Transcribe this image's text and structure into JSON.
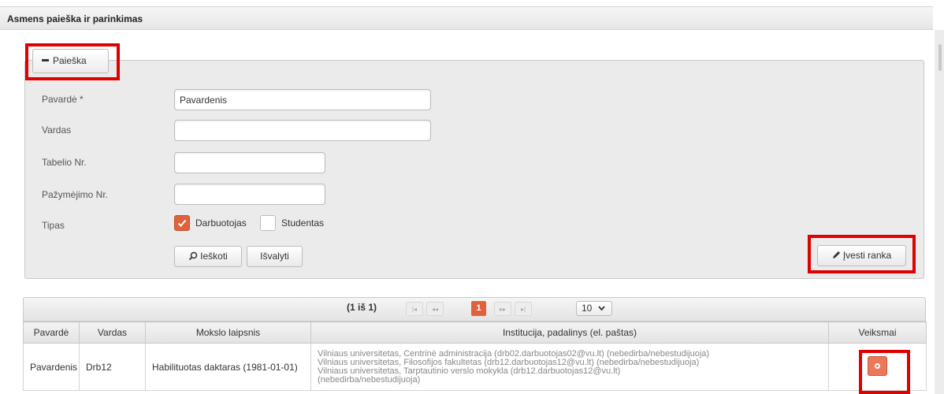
{
  "panel_title": "Asmens paieška ir parinkimas",
  "search": {
    "toggle_label": "Paieška",
    "fields": {
      "surname_label": "Pavardė *",
      "surname_value": "Pavardenis",
      "name_label": "Vardas",
      "name_value": "",
      "tab_label": "Tabelio Nr.",
      "tab_value": "",
      "cert_label": "Pažymėjimo Nr.",
      "cert_value": "",
      "type_label": "Tipas"
    },
    "types": [
      {
        "label": "Darbuotojas",
        "checked": true
      },
      {
        "label": "Studentas",
        "checked": false
      }
    ],
    "search_button": "Ieškoti",
    "clear_button": "Išvalyti",
    "manual_button": "Įvesti ranka"
  },
  "pagination": {
    "summary": "(1 iš 1)",
    "first": "|◂",
    "prev": "◂◂",
    "current": "1",
    "next": "▸▸",
    "last": "▸|",
    "rows_per_page": "10"
  },
  "table": {
    "columns": [
      "Pavardė",
      "Vardas",
      "Mokslo laipsnis",
      "Institucija, padalinys (el. paštas)",
      "Veiksmai"
    ],
    "rows": [
      {
        "surname": "Pavardenis",
        "name": "Drb12",
        "degree": "Habilituotas daktaras (1981-01-01)",
        "institutions": [
          "Vilniaus universitetas, Centrinė administracija (drb02.darbuotojas02@vu.lt) (nebedirba/nebestudijuoja)",
          "Vilniaus universitetas, Filosofijos fakultetas (drb12.darbuotojas12@vu.lt) (nebedirba/nebestudijuoja)",
          "Vilniaus universitetas, Tarptautinio verslo mokykla (drb12.darbuotojas12@vu.lt)",
          "(nebedirba/nebestudijuoja)"
        ]
      }
    ]
  },
  "colors": {
    "accent": "#e0623d",
    "highlight": "#e00000"
  }
}
